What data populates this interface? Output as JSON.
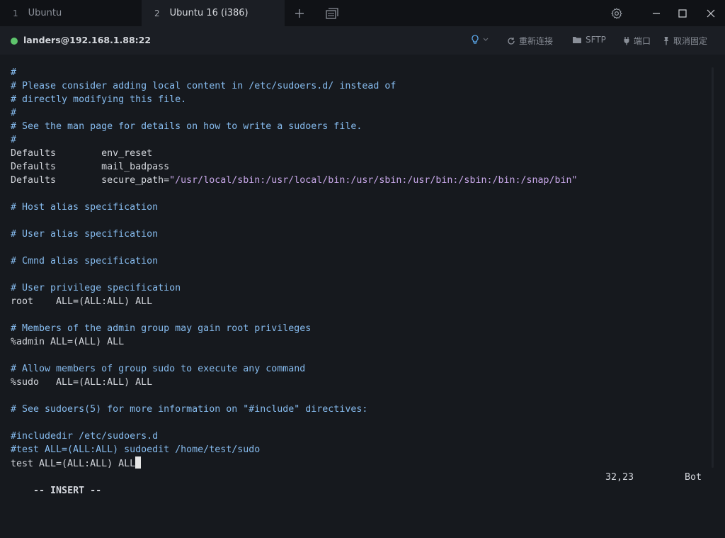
{
  "tabs": [
    {
      "number": "1",
      "label": "Ubuntu"
    },
    {
      "number": "2",
      "label": "Ubuntu 16 (i386)"
    }
  ],
  "connection": {
    "host": "landers@192.168.1.88:22",
    "status_color": "#5ec46c",
    "actions": {
      "reconnect": "重新连接",
      "sftp": "SFTP",
      "port": "端口",
      "unpin": "取消固定"
    }
  },
  "terminal": {
    "lines": [
      [
        {
          "t": "#",
          "k": "c"
        }
      ],
      [
        {
          "t": "# Please consider adding local content in /etc/sudoers.d/ instead of",
          "k": "c"
        }
      ],
      [
        {
          "t": "# directly modifying this file.",
          "k": "c"
        }
      ],
      [
        {
          "t": "#",
          "k": "c"
        }
      ],
      [
        {
          "t": "# See the man page for details on how to write a sudoers file.",
          "k": "c"
        }
      ],
      [
        {
          "t": "#",
          "k": "c"
        }
      ],
      [
        {
          "t": "Defaults        env_reset",
          "k": ""
        }
      ],
      [
        {
          "t": "Defaults        mail_badpass",
          "k": ""
        }
      ],
      [
        {
          "t": "Defaults        secure_path=",
          "k": ""
        },
        {
          "t": "\"/usr/local/sbin:/usr/local/bin:/usr/sbin:/usr/bin:/sbin:/bin:/snap/bin\"",
          "k": "s"
        }
      ],
      [],
      [
        {
          "t": "# Host alias specification",
          "k": "c"
        }
      ],
      [],
      [
        {
          "t": "# User alias specification",
          "k": "c"
        }
      ],
      [],
      [
        {
          "t": "# Cmnd alias specification",
          "k": "c"
        }
      ],
      [],
      [
        {
          "t": "# User privilege specification",
          "k": "c"
        }
      ],
      [
        {
          "t": "root    ALL=(ALL:ALL) ALL",
          "k": ""
        }
      ],
      [],
      [
        {
          "t": "# Members of the admin group may gain root privileges",
          "k": "c"
        }
      ],
      [
        {
          "t": "%admin ALL=(ALL) ALL",
          "k": ""
        }
      ],
      [],
      [
        {
          "t": "# Allow members of group sudo to execute any command",
          "k": "c"
        }
      ],
      [
        {
          "t": "%sudo   ALL=(ALL:ALL) ALL",
          "k": ""
        }
      ],
      [],
      [
        {
          "t": "# See sudoers(5) for more information on \"#include\" directives:",
          "k": "c"
        }
      ],
      [],
      [
        {
          "t": "#includedir /etc/sudoers.d",
          "k": "c"
        }
      ],
      [
        {
          "t": "#test ALL=(ALL:ALL) sudoedit /home/test/sudo",
          "k": "c"
        }
      ],
      [
        {
          "t": "test ALL=(ALL:ALL) ALL",
          "k": ""
        }
      ]
    ],
    "cursor_line": 29
  },
  "status": {
    "mode": "-- INSERT --",
    "position": "32,23",
    "scroll": "Bot"
  }
}
